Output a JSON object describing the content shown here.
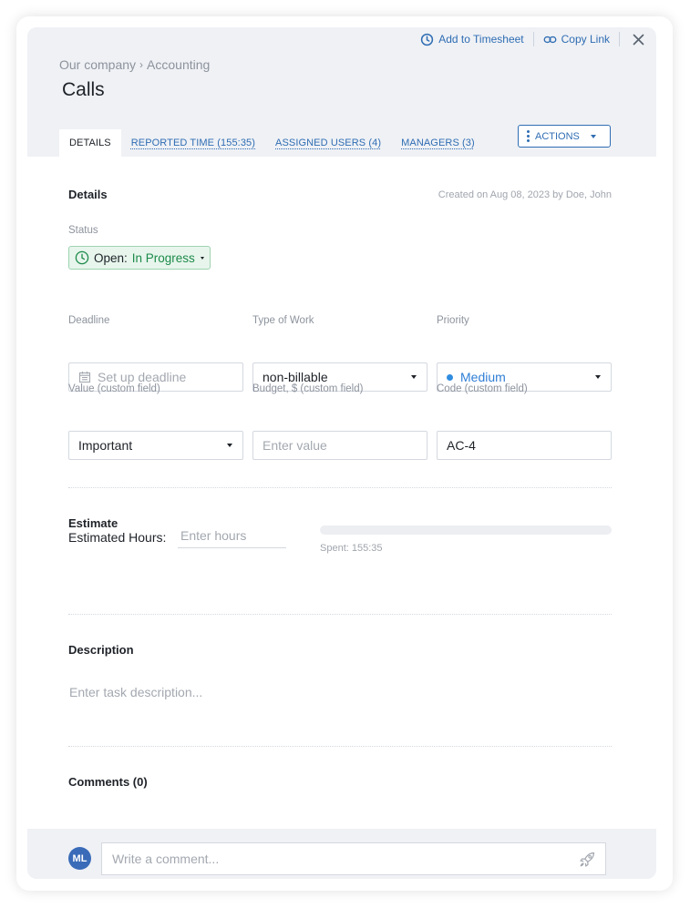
{
  "header": {
    "add_timesheet": "Add to Timesheet",
    "copy_link": "Copy Link",
    "breadcrumb": [
      "Our company",
      "Accounting"
    ],
    "breadcrumb_separator": "›",
    "title": "Calls"
  },
  "tabs": [
    {
      "label": "DETAILS",
      "active": true
    },
    {
      "label": "REPORTED TIME (155:35)",
      "active": false
    },
    {
      "label": "ASSIGNED USERS (4)",
      "active": false
    },
    {
      "label": "MANAGERS (3)",
      "active": false
    }
  ],
  "actions_label": "ACTIONS",
  "details": {
    "title": "Details",
    "created": "Created on Aug 08, 2023 by Doe, John",
    "status_label": "Status",
    "status_state": "Open:",
    "status_value": "In Progress",
    "deadline_label": "Deadline",
    "deadline_placeholder": "Set up deadline",
    "type_label": "Type of Work",
    "type_value": "non-billable",
    "priority_label": "Priority",
    "priority_value": "Medium",
    "value_label": "Value (custom field)",
    "value_value": "Important",
    "budget_label": "Budget, $ (custom field)",
    "budget_placeholder": "Enter value",
    "code_label": "Code (custom field)",
    "code_value": "AC-4"
  },
  "estimate": {
    "title": "Estimate",
    "hours_label": "Estimated Hours:",
    "hours_placeholder": "Enter hours",
    "spent": "Spent: 155:35",
    "progress_fraction": 0
  },
  "description": {
    "title": "Description",
    "placeholder": "Enter task description..."
  },
  "comments": {
    "title": "Comments (0)",
    "avatar_initials": "ML",
    "placeholder": "Write a comment..."
  },
  "colors": {
    "accent": "#2f6db3",
    "status_green": "#1d8a4a",
    "priority_blue": "#2f8de0",
    "panel_bg": "#eff1f5"
  }
}
